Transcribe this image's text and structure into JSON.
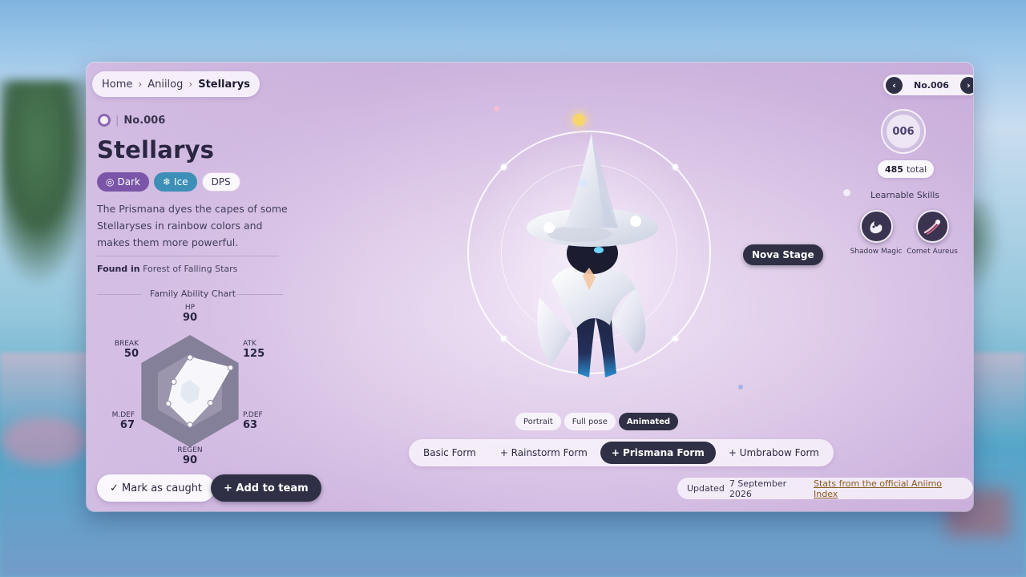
{
  "breadcrumb": [
    "Home",
    "Aniilog",
    "Stellarys"
  ],
  "entry": {
    "number": "No.006",
    "name": "Stellarys",
    "tags": [
      {
        "label": "Dark",
        "color": "#7a55a8"
      },
      {
        "label": "Ice",
        "color": "#3d8fb8"
      },
      {
        "label": "DPS"
      }
    ],
    "description": "The Prismana dyes the capes of some Stellaryses in rainbow colors and makes them more powerful.",
    "found_label": "Found in",
    "found_value": "Forest of Falling Stars"
  },
  "ability_chart": {
    "title": "Family Ability Chart",
    "max": 150,
    "stats": [
      {
        "label": "HP",
        "value": 90
      },
      {
        "label": "ATK",
        "value": 125
      },
      {
        "label": "P.DEF",
        "value": 63
      },
      {
        "label": "REGEN",
        "value": 90
      },
      {
        "label": "M.DEF",
        "value": 67
      },
      {
        "label": "BREAK",
        "value": 50
      }
    ]
  },
  "actions": {
    "caught": "✓ Mark as caught",
    "team": "+ Add to team"
  },
  "stage_label": "Nova Stage",
  "views": [
    {
      "label": "Portrait",
      "active": false
    },
    {
      "label": "Full pose",
      "active": false
    },
    {
      "label": "Animated",
      "active": true
    }
  ],
  "forms": [
    {
      "label": "Basic Form",
      "active": false
    },
    {
      "label": "+ Rainstorm Form",
      "active": false
    },
    {
      "label": "+ Prismana Form",
      "active": true
    },
    {
      "label": "+ Umbrabow Form",
      "active": false
    }
  ],
  "nav": {
    "prev": "‹",
    "next": "›",
    "number": "No.006"
  },
  "badge_number": "006",
  "total": {
    "value": "485",
    "label": "total"
  },
  "skills": {
    "title": "Learnable Skills",
    "items": [
      {
        "name": "Shadow Magic",
        "icon": "shadow-magic-icon"
      },
      {
        "name": "Comet Aureus",
        "icon": "comet-aureus-icon"
      }
    ]
  },
  "footer": {
    "updated_label": "Updated",
    "updated_date": "7 September 2026",
    "source_link": "Stats from the official Aniimo Index"
  }
}
